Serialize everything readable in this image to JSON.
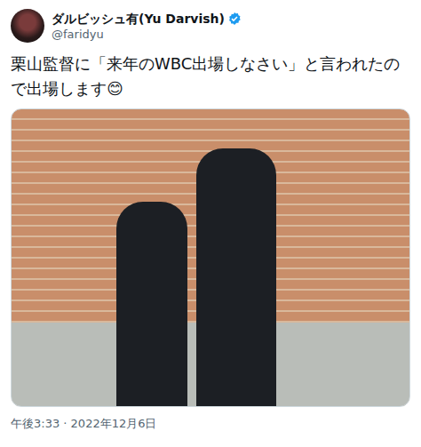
{
  "user": {
    "name": "ダルビッシュ有(Yu Darvish)",
    "handle": "@faridyu",
    "verified": true
  },
  "tweet": {
    "text": "栗山監督に「来年のWBC出場しなさい」と言われたので出場します😊"
  },
  "timestamp": "午後3:33 · 2022年12月6日"
}
